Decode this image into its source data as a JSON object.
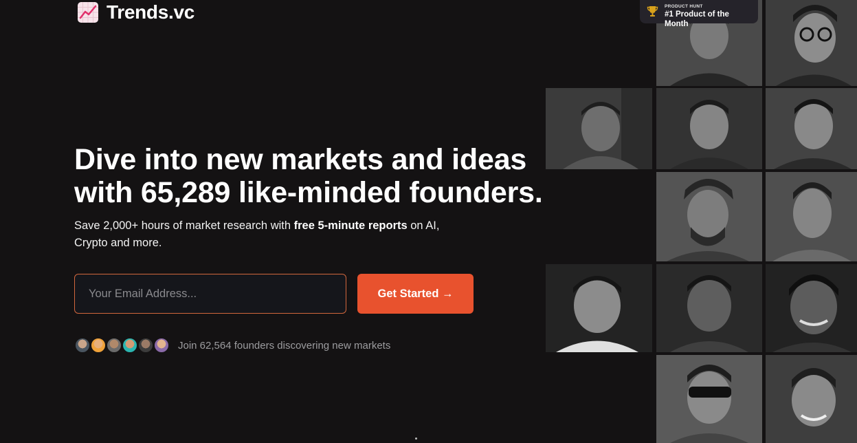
{
  "brand": {
    "name": "Trends.vc",
    "logo_icon": "trend-chart-icon"
  },
  "product_hunt": {
    "eyebrow": "PRODUCT HUNT",
    "title": "#1 Product of the Month",
    "icon": "trophy-icon"
  },
  "hero": {
    "headline_line1": "Dive into new markets and ideas",
    "headline_line2": "with 65,289 like-minded founders.",
    "sub_before": "Save 2,000+ hours of market research with ",
    "sub_bold": "free 5-minute reports",
    "sub_after": " on AI, Crypto and more."
  },
  "signup": {
    "email_placeholder": "Your Email Address...",
    "cta_label": "Get Started →"
  },
  "social_proof": {
    "text": "Join 62,564 founders discovering new markets"
  },
  "colors": {
    "background": "#141213",
    "accent": "#e8522e",
    "input_border": "#d2673d"
  }
}
